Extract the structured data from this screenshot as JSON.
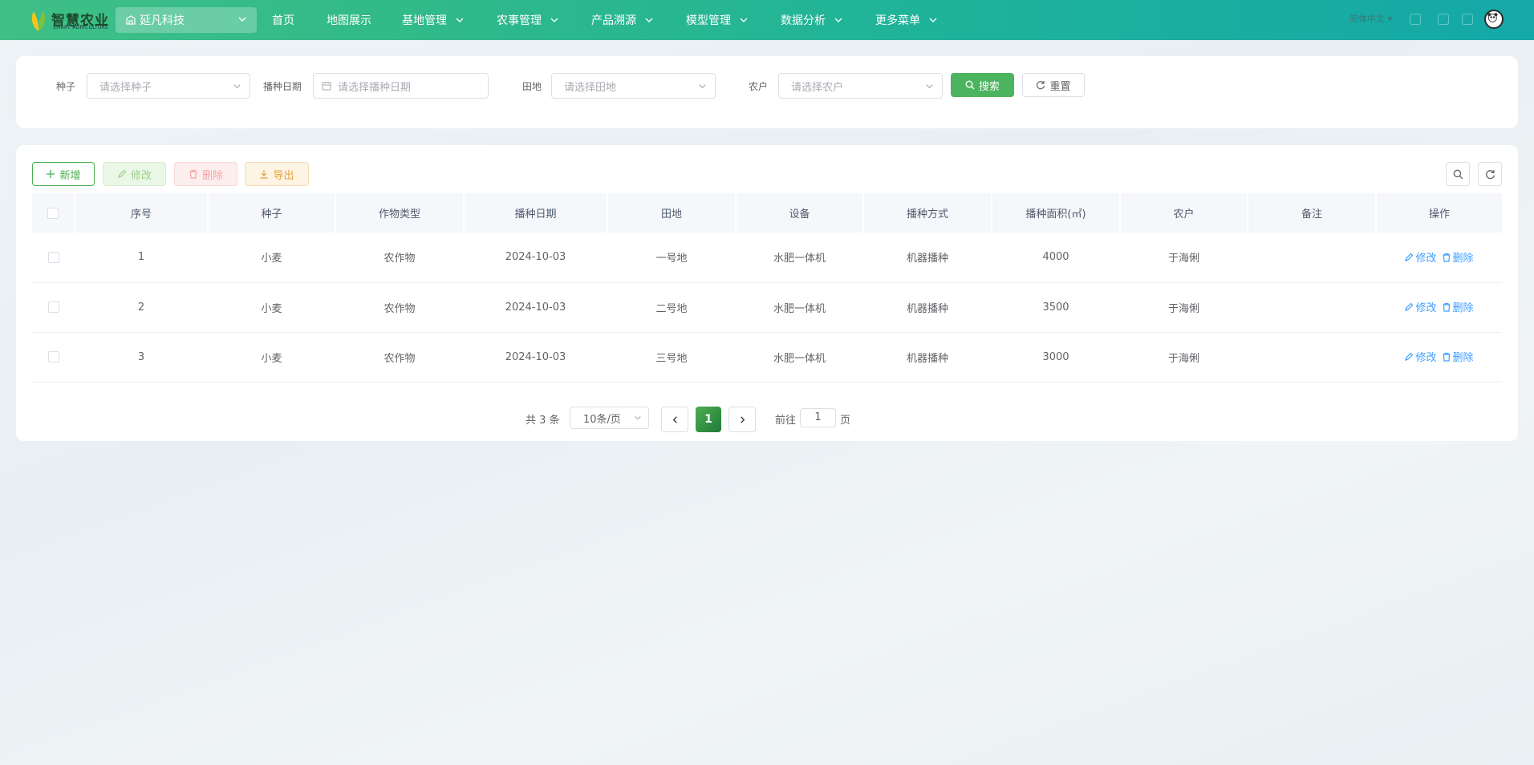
{
  "topbar": {
    "brand": "智慧农业",
    "brand_sub": "SMART AGRICULTURE",
    "org": "延凡科技",
    "nav": [
      "首页",
      "地图展示",
      "基地管理",
      "农事管理",
      "产品溯源",
      "模型管理",
      "数据分析",
      "更多菜单"
    ],
    "language": "简体中文"
  },
  "search": {
    "seed_label": "种子",
    "seed_placeholder": "请选择种子",
    "date_label": "播种日期",
    "date_placeholder": "请选择播种日期",
    "field_label": "田地",
    "field_placeholder": "请选择田地",
    "farmer_label": "农户",
    "farmer_placeholder": "请选择农户",
    "search_btn": "搜索",
    "reset_btn": "重置"
  },
  "toolbar": {
    "add": "新增",
    "edit": "修改",
    "delete": "删除",
    "export": "导出"
  },
  "table": {
    "headers": [
      "序号",
      "种子",
      "作物类型",
      "播种日期",
      "田地",
      "设备",
      "播种方式",
      "播种面积(㎡)",
      "农户",
      "备注",
      "操作"
    ],
    "rows": [
      {
        "no": "1",
        "seed": "小麦",
        "type": "农作物",
        "date": "2024-10-03",
        "field": "一号地",
        "device": "水肥一体机",
        "method": "机器播种",
        "area": "4000",
        "farmer": "于海俐",
        "remark": ""
      },
      {
        "no": "2",
        "seed": "小麦",
        "type": "农作物",
        "date": "2024-10-03",
        "field": "二号地",
        "device": "水肥一体机",
        "method": "机器播种",
        "area": "3500",
        "farmer": "于海俐",
        "remark": ""
      },
      {
        "no": "3",
        "seed": "小麦",
        "type": "农作物",
        "date": "2024-10-03",
        "field": "三号地",
        "device": "水肥一体机",
        "method": "机器播种",
        "area": "3000",
        "farmer": "于海俐",
        "remark": ""
      }
    ],
    "op_edit": "修改",
    "op_delete": "删除"
  },
  "pagination": {
    "total": "共 3 条",
    "page_size": "10条/页",
    "current": "1",
    "goto_label": "前往",
    "goto_value": "1",
    "page_suffix": "页"
  },
  "colors": {
    "primary": "#4cb45e",
    "link": "#409eff",
    "warning": "#e6a23c",
    "danger": "#f56c6c"
  }
}
